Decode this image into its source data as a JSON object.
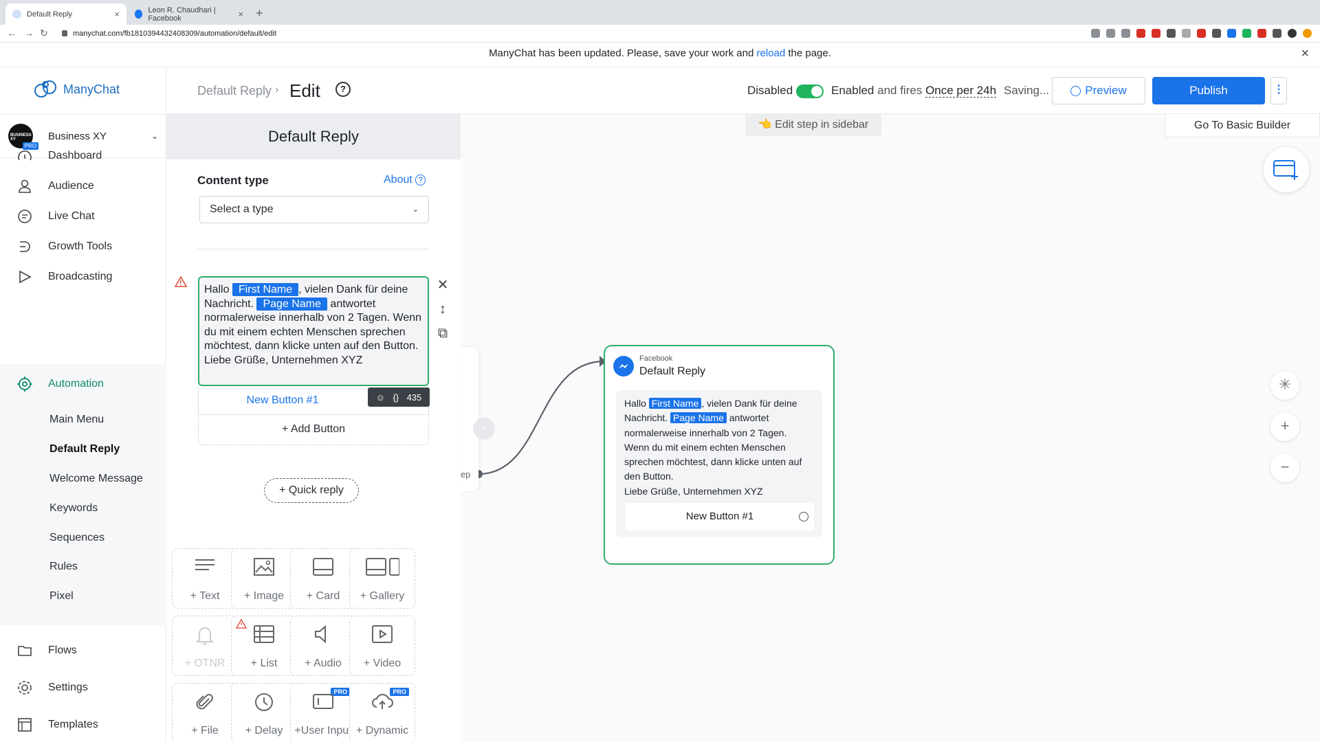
{
  "browser": {
    "tabs": [
      {
        "title": "Default Reply",
        "active": true
      },
      {
        "title": "Leon R. Chaudhari | Facebook",
        "active": false
      }
    ],
    "url": "manychat.com/fb181039443240830​9/automation/default/edit"
  },
  "banner": {
    "text_before": "ManyChat has been updated. Please, save your work and ",
    "link": "reload",
    "text_after": " the page."
  },
  "sidebar": {
    "brand": "ManyChat",
    "account": {
      "name": "Business XY",
      "avatar_text": "BUSINESS XY",
      "badge": "PRO"
    },
    "nav": [
      {
        "label": "Dashboard",
        "icon": "dashboard-icon"
      },
      {
        "label": "Audience",
        "icon": "person-icon"
      },
      {
        "label": "Live Chat",
        "icon": "chat-bubble-icon"
      },
      {
        "label": "Growth Tools",
        "icon": "growth-tools-icon"
      },
      {
        "label": "Broadcasting",
        "icon": "send-icon"
      },
      {
        "label": "Automation",
        "icon": "automation-icon",
        "active": true
      },
      {
        "label": "Flows",
        "icon": "folder-icon"
      },
      {
        "label": "Settings",
        "icon": "gear-icon"
      },
      {
        "label": "Templates",
        "icon": "templates-icon"
      }
    ],
    "automation_sub": [
      "Main Menu",
      "Default Reply",
      "Welcome Message",
      "Keywords",
      "Sequences",
      "Rules",
      "Pixel"
    ]
  },
  "header": {
    "crumb_parent": "Default Reply",
    "crumb_current": "Edit",
    "help": "?",
    "disabled_label": "Disabled",
    "enabled_label": "Enabled",
    "fires_label": "and fires",
    "fires_value": "Once per 24h",
    "saving": "Saving...",
    "preview": "Preview",
    "publish": "Publish",
    "more": "⋮",
    "toggle_on": true
  },
  "panel": {
    "title": "Default Reply",
    "content_type_label": "Content type",
    "about": "About",
    "select_placeholder": "Select a type",
    "message": {
      "p1": "Hallo ",
      "tag1": "First Name",
      "p2": ", vielen Dank für deine Nachricht. ",
      "tag2": "Page Name",
      "p3": " antwortet normalerweise innerhalb von 2 Tagen. Wenn du mit einem echten Menschen sprechen möchtest, dann klicke unten auf den Button.",
      "p4": "Liebe Grüße, Unternehmen XYZ"
    },
    "button_label": "New Button #1",
    "counter": "435",
    "add_button": "+ Add Button",
    "quick_reply": "+ Quick reply",
    "tiles": [
      {
        "label": "+ Text",
        "icon": "text-icon"
      },
      {
        "label": "+ Image",
        "icon": "image-icon"
      },
      {
        "label": "+ Card",
        "icon": "card-icon"
      },
      {
        "label": "+ Gallery",
        "icon": "gallery-icon"
      },
      {
        "label": "+ OTNR",
        "icon": "bell-icon",
        "disabled": true
      },
      {
        "label": "+ List",
        "icon": "list-icon",
        "warning": true
      },
      {
        "label": "+ Audio",
        "icon": "audio-icon"
      },
      {
        "label": "+ Video",
        "icon": "video-icon"
      },
      {
        "label": "+ File",
        "icon": "paperclip-icon"
      },
      {
        "label": "+ Delay",
        "icon": "clock-icon"
      },
      {
        "label": "+User Input",
        "icon": "user-input-icon",
        "pro": "PRO"
      },
      {
        "label": "+ Dynamic",
        "icon": "cloud-icon",
        "pro": "PRO"
      }
    ]
  },
  "canvas": {
    "edit_hint": "Edit step in sidebar",
    "basic_builder": "Go To Basic Builder",
    "ghost_label": "ep",
    "node": {
      "source": "Facebook",
      "title": "Default Reply",
      "button": "New Button #1"
    },
    "zoom_in": "+",
    "zoom_out": "−"
  },
  "colors": {
    "accent": "#1a73e8",
    "success": "#2dac6c",
    "automation": "#0a8a6a"
  }
}
